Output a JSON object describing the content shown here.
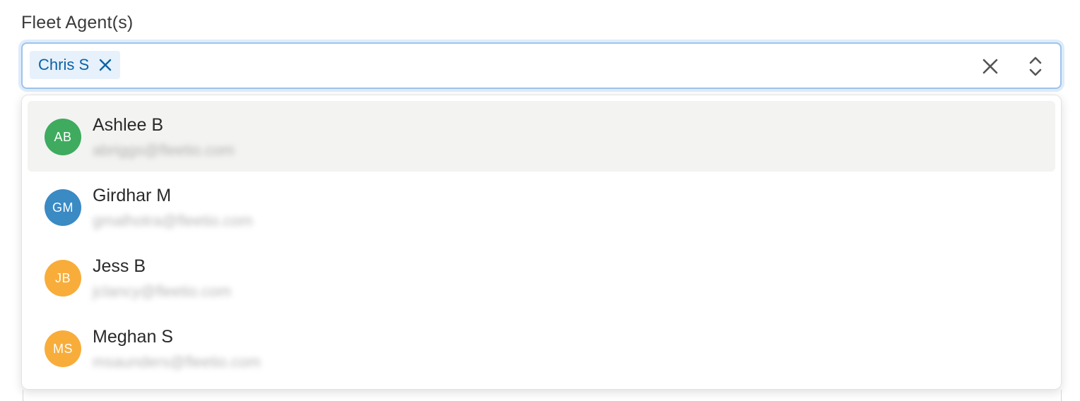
{
  "field": {
    "label": "Fleet Agent(s)",
    "selected_chips": [
      {
        "label": "Chris S"
      }
    ]
  },
  "icons": {
    "chip_remove": "close-icon",
    "clear": "close-icon",
    "toggle": "chevron-up-down-icon"
  },
  "colors": {
    "focus_border": "#9ec3ea",
    "chip_bg": "#e6f1fb",
    "chip_text": "#0c62a6",
    "highlight_bg": "#f3f3f2"
  },
  "options": [
    {
      "initials": "AB",
      "name": "Ashlee B",
      "email": "abriggs@fleetio.com",
      "avatar_color": "#3eab5e"
    },
    {
      "initials": "GM",
      "name": "Girdhar M",
      "email": "gmalhotra@fleetio.com",
      "avatar_color": "#3a8ac4"
    },
    {
      "initials": "JB",
      "name": "Jess B",
      "email": "jclancy@fleetio.com",
      "avatar_color": "#f8ad3b"
    },
    {
      "initials": "MS",
      "name": "Meghan S",
      "email": "msaunders@fleetio.com",
      "avatar_color": "#f8ad3b"
    }
  ]
}
